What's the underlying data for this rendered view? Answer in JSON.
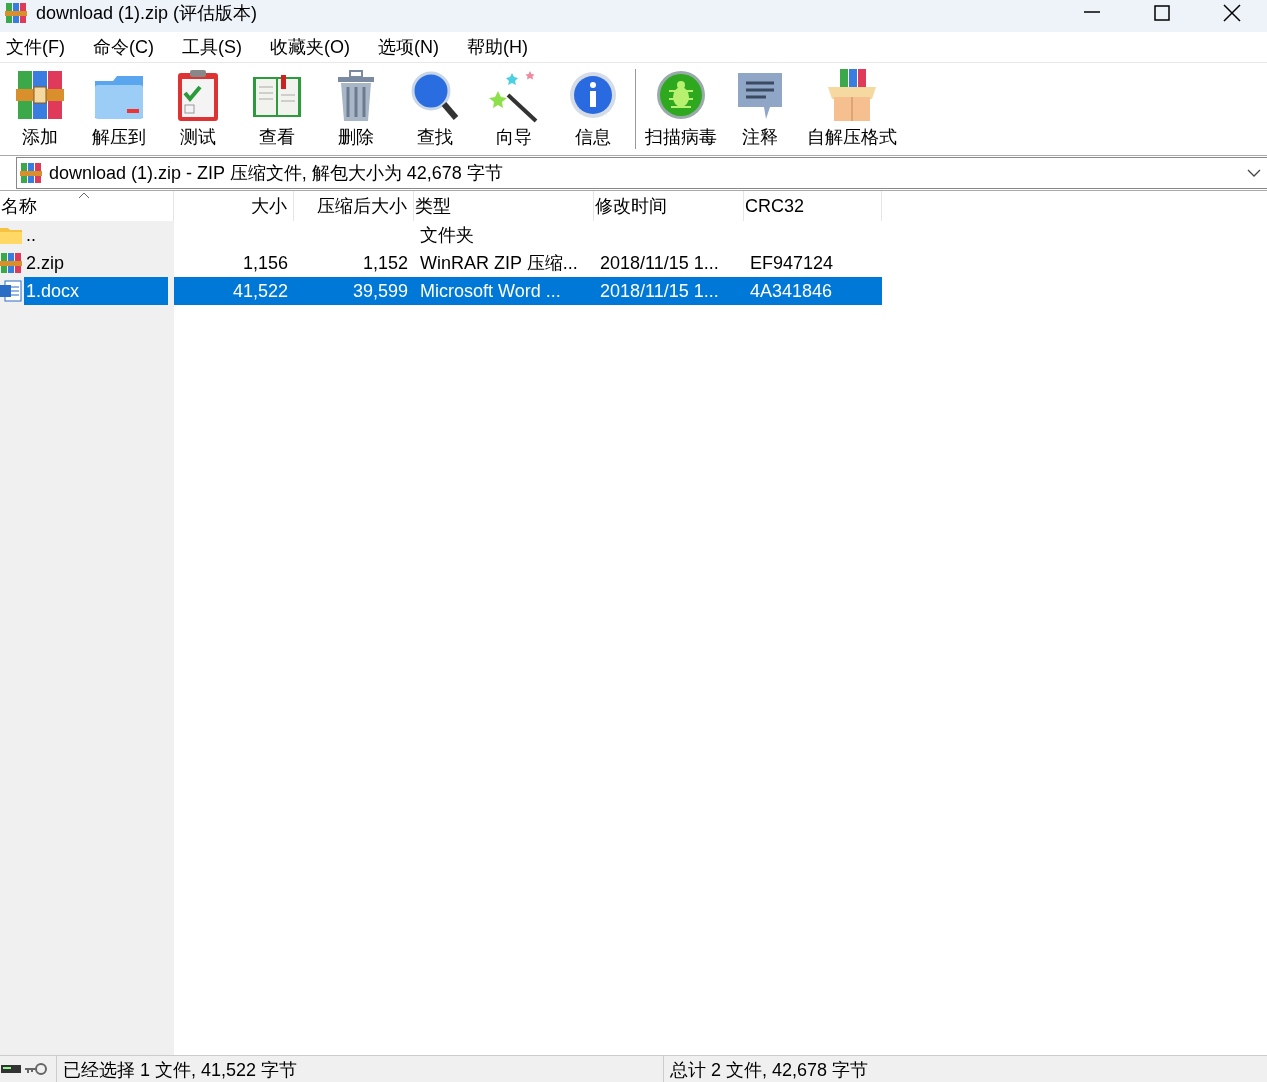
{
  "window": {
    "title": "download (1).zip (评估版本)"
  },
  "menu": [
    "文件(F)",
    "命令(C)",
    "工具(S)",
    "收藏夹(O)",
    "选项(N)",
    "帮助(H)"
  ],
  "toolbar": [
    {
      "label": "添加",
      "kind": "add"
    },
    {
      "label": "解压到",
      "kind": "extract"
    },
    {
      "label": "测试",
      "kind": "test"
    },
    {
      "label": "查看",
      "kind": "view"
    },
    {
      "label": "删除",
      "kind": "delete"
    },
    {
      "label": "查找",
      "kind": "find"
    },
    {
      "label": "向导",
      "kind": "wizard"
    },
    {
      "label": "信息",
      "kind": "info"
    },
    {
      "kind": "separator"
    },
    {
      "label": "扫描病毒",
      "kind": "virus"
    },
    {
      "label": "注释",
      "kind": "comment"
    },
    {
      "label": "自解压格式",
      "kind": "sfx"
    }
  ],
  "address": {
    "text": "download (1).zip - ZIP 压缩文件, 解包大小为 42,678 字节"
  },
  "table": {
    "columns": [
      {
        "label": "名称",
        "sorted": true
      },
      {
        "label": "大小",
        "sorted": false
      },
      {
        "label": "压缩后大小",
        "sorted": false
      },
      {
        "label": "类型",
        "sorted": false
      },
      {
        "label": "修改时间",
        "sorted": false
      },
      {
        "label": "CRC32",
        "sorted": false
      }
    ],
    "rows": [
      {
        "kind": "folder",
        "selected": false,
        "cells": [
          "..",
          "",
          "",
          "文件夹",
          "",
          ""
        ]
      },
      {
        "kind": "archive",
        "selected": false,
        "cells": [
          "2.zip",
          "1,156",
          "1,152",
          "WinRAR ZIP 压缩...",
          "2018/11/15 1...",
          "EF947124"
        ]
      },
      {
        "kind": "document",
        "selected": true,
        "cells": [
          "1.docx",
          "41,522",
          "39,599",
          "Microsoft Word ...",
          "2018/11/15 1...",
          "4A341846"
        ]
      }
    ]
  },
  "status_bar": {
    "left": "已经选择 1 文件, 41,522 字节",
    "right": "总计 2 文件, 42,678 字节"
  }
}
